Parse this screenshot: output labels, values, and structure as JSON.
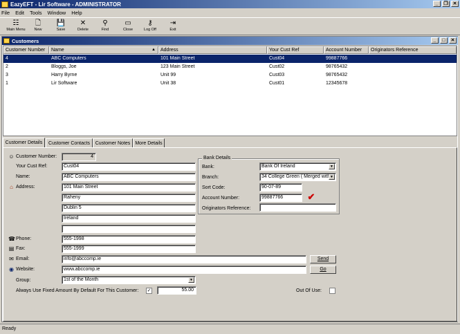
{
  "window": {
    "title": "EazyEFT - Lir Software - ADMINISTRATOR"
  },
  "menu": [
    "File",
    "Edit",
    "Tools",
    "Window",
    "Help"
  ],
  "toolbar": [
    {
      "label": "Main Menu",
      "icon": "main-menu-icon",
      "glyph": "☷"
    },
    {
      "label": "New",
      "icon": "new-icon",
      "glyph": "🗋"
    },
    {
      "label": "Save",
      "icon": "save-icon",
      "glyph": "💾"
    },
    {
      "label": "Delete",
      "icon": "delete-icon",
      "glyph": "✕"
    },
    {
      "label": "Find",
      "icon": "binoculars-icon",
      "glyph": "⚲"
    },
    {
      "label": "Close",
      "icon": "close-doc-icon",
      "glyph": "▭"
    },
    {
      "label": "Log Off",
      "icon": "key-icon",
      "glyph": "⚷"
    },
    {
      "label": "Exit",
      "icon": "exit-icon",
      "glyph": "⇥"
    }
  ],
  "child_window": {
    "title": "Customers"
  },
  "grid": {
    "columns": [
      "Customer Number",
      "Name",
      "Address",
      "Your Cust Ref",
      "Account Number",
      "Originators Reference"
    ],
    "rows": [
      [
        "4",
        "ABC Computers",
        "101 Main Street",
        "Cust04",
        "99887766",
        ""
      ],
      [
        "2",
        "Bloggs, Joe",
        "123 Main Street",
        "Cust02",
        "98765432",
        ""
      ],
      [
        "3",
        "Harry Byrne",
        "Unit 99",
        "Cust03",
        "98765432",
        ""
      ],
      [
        "1",
        "Lir Software",
        "Unit 38",
        "Cust01",
        "12345678",
        ""
      ]
    ]
  },
  "tabs": [
    "Customer Details",
    "Customer Contacts",
    "Customer Notes",
    "More Details"
  ],
  "form": {
    "customer_number_label": "Customer Number:",
    "customer_number": "4",
    "your_cust_ref_label": "Your Cust Ref:",
    "your_cust_ref": "Cust04",
    "name_label": "Name:",
    "name": "ABC Computers",
    "address_label": "Address:",
    "address": [
      "101 Main Street",
      "Raheny",
      "Dublin 5",
      "Ireland",
      ""
    ],
    "phone_label": "Phone:",
    "phone": "555-1998",
    "fax_label": "Fax:",
    "fax": "555-1999",
    "email_label": "Email:",
    "email": "info@abccomp.ie",
    "send_button": "Send",
    "website_label": "Website:",
    "website": "www.abccomp.ie",
    "go_button": "Go",
    "group_label": "Group:",
    "group": "1st of the Month",
    "fixed_amount_label": "Always Use Fixed Amount By Default For This Customer:",
    "fixed_amount_checked": "✓",
    "fixed_amount": "55.00",
    "out_of_use_label": "Out Of Use:",
    "bank": {
      "legend": "Bank Details",
      "bank_label": "Bank:",
      "bank": "Bank Of Ireland",
      "branch_label": "Branch:",
      "branch": "34 College Green ( Merged with",
      "sort_code_label": "Sort Code:",
      "sort_code": "90-07-89",
      "account_number_label": "Account Number:",
      "account_number": "99887766",
      "originators_reference_label": "Originators Reference:",
      "originators_reference": ""
    }
  },
  "status": "Ready",
  "colors": {
    "titlebar": "#0a246a",
    "selection": "#0a246a",
    "face": "#d4d0c8",
    "check_mark": "#cc0000"
  }
}
